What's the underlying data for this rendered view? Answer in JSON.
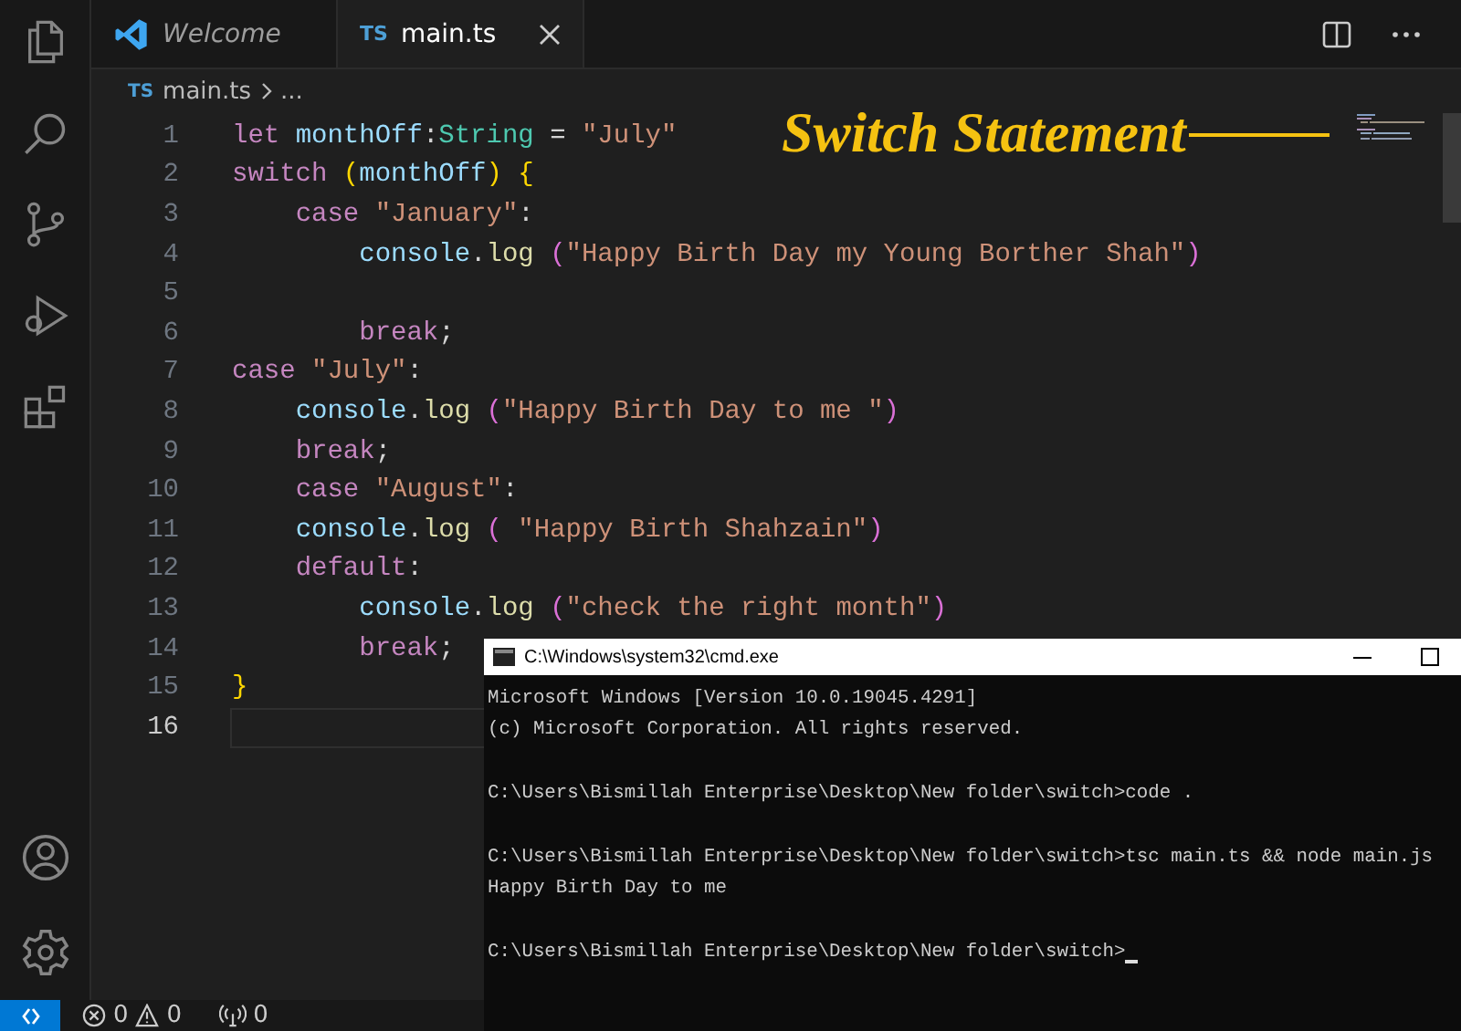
{
  "activity_bar": {
    "items": [
      {
        "kind": "files",
        "selected": false
      },
      {
        "kind": "search",
        "selected": false
      },
      {
        "kind": "source-control",
        "selected": false
      },
      {
        "kind": "run-debug",
        "selected": false
      },
      {
        "kind": "extensions",
        "selected": false
      }
    ],
    "bottom_items": [
      {
        "kind": "account"
      },
      {
        "kind": "settings"
      }
    ]
  },
  "tabs": [
    {
      "label": "Welcome",
      "kind": "preview",
      "selected": false
    },
    {
      "label": "main.ts",
      "badge": "TS",
      "kind": "file",
      "selected": true
    }
  ],
  "breadcrumb": {
    "badge": "TS",
    "file": "main.ts",
    "rest": "..."
  },
  "overlay_title": "Switch Statement",
  "code": {
    "lines": [
      {
        "number": "1",
        "current": false,
        "text": "let monthOff:String = \"July\""
      },
      {
        "number": "2",
        "current": false,
        "text": "switch (monthOff) {"
      },
      {
        "number": "3",
        "current": false,
        "text": "    case \"January\":"
      },
      {
        "number": "4",
        "current": false,
        "text": "        console.log (\"Happy Birth Day my Young Borther Shah\")"
      },
      {
        "number": "5",
        "current": false
      },
      {
        "number": "6",
        "current": false,
        "text": "        break;"
      },
      {
        "number": "7",
        "current": false,
        "text": "case \"July\":"
      },
      {
        "number": "8",
        "current": false,
        "text": "    console.log (\"Happy Birth Day to me \")"
      },
      {
        "number": "9",
        "current": false,
        "text": "    break;"
      },
      {
        "number": "10",
        "current": false,
        "text": "    case \"August\":"
      },
      {
        "number": "11",
        "current": false,
        "text": "    console.log ( \"Happy Birth Shahzain\")"
      },
      {
        "number": "12",
        "current": false,
        "text": "    default:"
      },
      {
        "number": "13",
        "current": false,
        "text": "        console.log (\"check the right month\")"
      },
      {
        "number": "14",
        "current": false,
        "text": "        break;"
      },
      {
        "number": "15",
        "current": false,
        "text": "}"
      },
      {
        "number": "16",
        "current": true
      }
    ]
  },
  "terminal": {
    "title": "C:\\Windows\\system32\\cmd.exe",
    "lines": [
      {
        "text": "Microsoft Windows [Version 10.0.19045.4291]",
        "blank_before": false
      },
      {
        "text": "(c) Microsoft Corporation. All rights reserved.",
        "blank_before": false
      },
      {
        "text": "C:\\Users\\Bismillah Enterprise\\Desktop\\New folder\\switch>code .",
        "blank_before": true
      },
      {
        "text": "C:\\Users\\Bismillah Enterprise\\Desktop\\New folder\\switch>tsc main.ts && node main.js",
        "blank_before": true
      },
      {
        "text": "Happy Birth Day to me",
        "blank_before": false
      },
      {
        "text": "C:\\Users\\Bismillah Enterprise\\Desktop\\New folder\\switch>",
        "blank_before": true
      }
    ],
    "cursor": true
  },
  "status_bar": {
    "errors": "0",
    "warnings": "0",
    "ports": "0"
  }
}
